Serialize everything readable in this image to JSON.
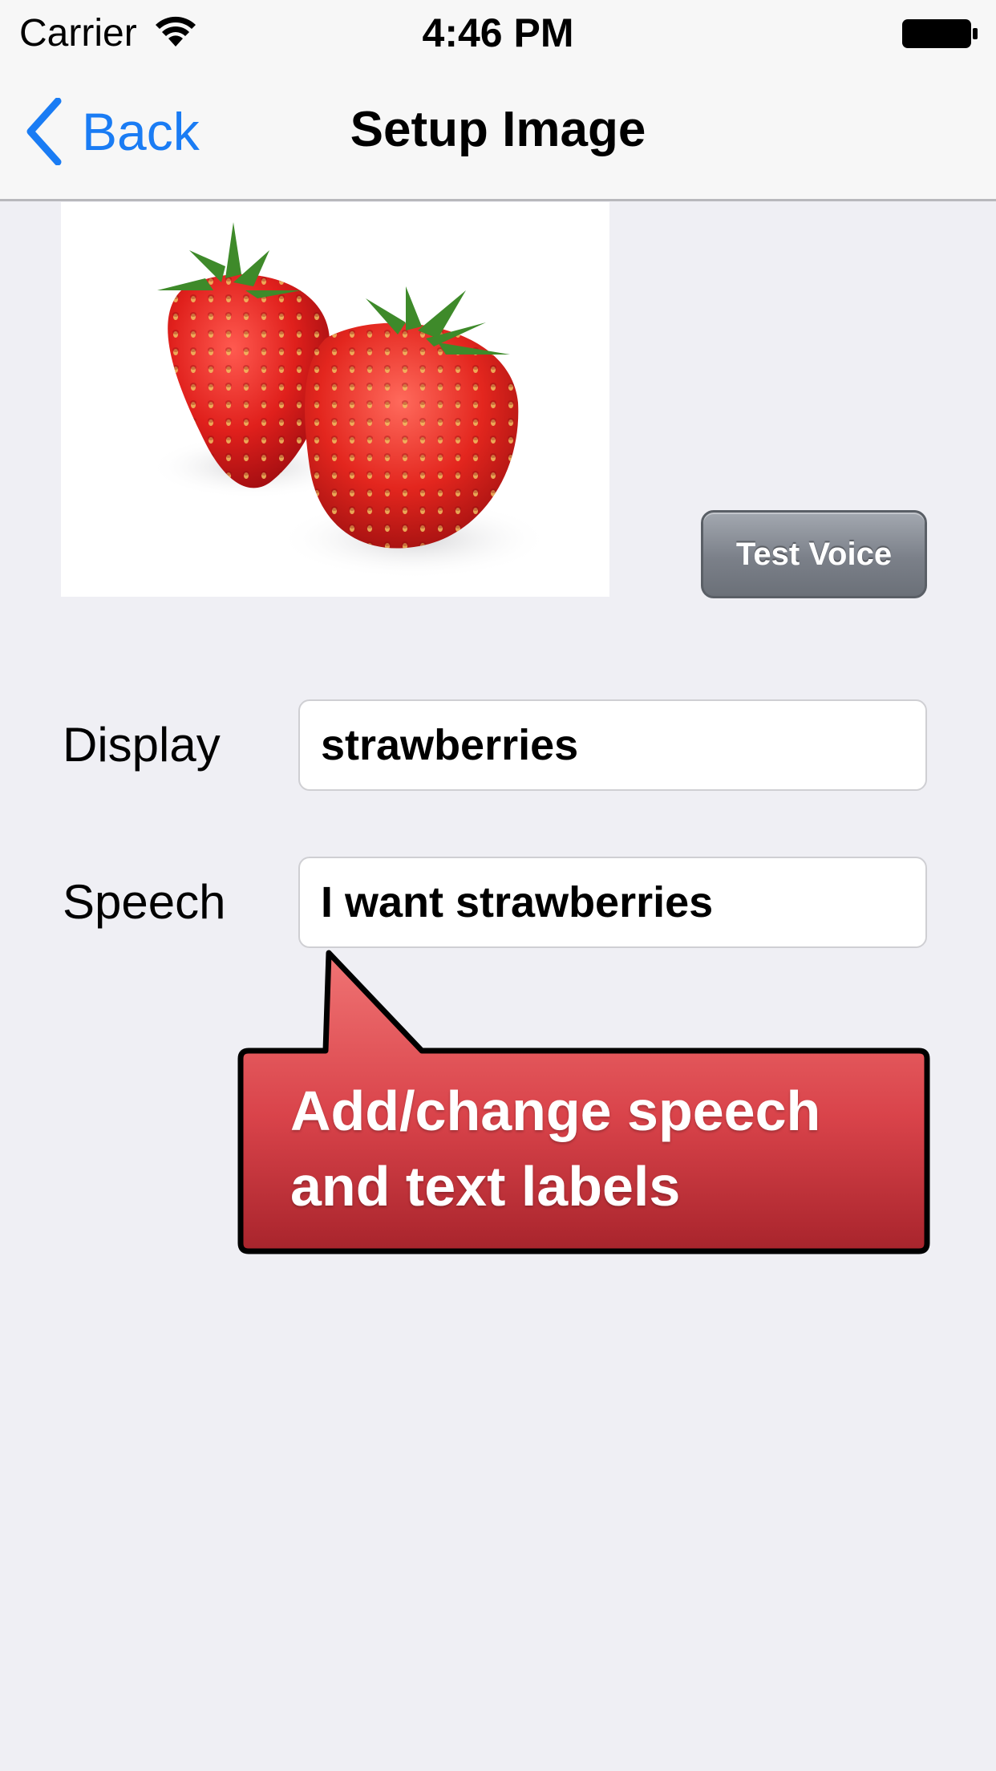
{
  "status_bar": {
    "carrier": "Carrier",
    "time": "4:46 PM",
    "wifi_icon": "wifi-icon",
    "battery_icon": "battery-icon"
  },
  "nav": {
    "back_label": "Back",
    "title": "Setup Image",
    "accent_color": "#1a7cf4"
  },
  "image": {
    "subject": "strawberries-photo"
  },
  "test_voice_label": "Test Voice",
  "form": {
    "display_label": "Display",
    "display_value": "strawberries",
    "speech_label": "Speech",
    "speech_value": "I want strawberries"
  },
  "callout": {
    "line1": "Add/change speech",
    "line2": "and text labels",
    "color": "#d9434a"
  }
}
